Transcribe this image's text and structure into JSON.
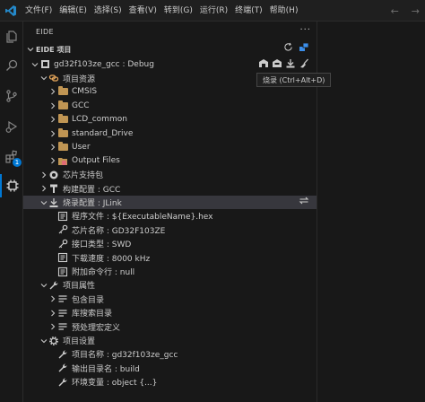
{
  "menubar": {
    "items": [
      "文件(F)",
      "编辑(E)",
      "选择(S)",
      "查看(V)",
      "转到(G)",
      "运行(R)",
      "终端(T)",
      "帮助(H)"
    ]
  },
  "sidebar": {
    "title": "EIDE",
    "more": "···",
    "section_title": "EIDE 项目",
    "project": {
      "label": "gd32f103ze_gcc : Debug",
      "children": [
        {
          "label": "项目资源",
          "icon": "link-icon",
          "children": [
            {
              "label": "CMSIS",
              "icon": "folder-icon"
            },
            {
              "label": "GCC",
              "icon": "folder-icon"
            },
            {
              "label": "LCD_common",
              "icon": "folder-icon"
            },
            {
              "label": "standard_Drive",
              "icon": "folder-icon"
            },
            {
              "label": "User",
              "icon": "folder-icon"
            },
            {
              "label": "Output Files",
              "icon": "output-folder-icon"
            }
          ]
        },
        {
          "label": "芯片支持包",
          "icon": "package-icon"
        },
        {
          "label": "构建配置 : GCC",
          "icon": "hammer-icon"
        },
        {
          "label": "烧录配置 : JLink",
          "icon": "download-icon",
          "children": [
            {
              "label": "程序文件 : ${ExecutableName}.hex",
              "icon": "file-list-icon"
            },
            {
              "label": "芯片名称 : GD32F103ZE",
              "icon": "key-icon"
            },
            {
              "label": "接口类型 : SWD",
              "icon": "key-icon"
            },
            {
              "label": "下载速度 : 8000 kHz",
              "icon": "file-list-icon"
            },
            {
              "label": "附加命令行 : null",
              "icon": "file-list-icon"
            }
          ]
        },
        {
          "label": "项目属性",
          "icon": "wrench-icon",
          "children": [
            {
              "label": "包含目录",
              "icon": "list-icon"
            },
            {
              "label": "库搜索目录",
              "icon": "list-icon"
            },
            {
              "label": "预处理宏定义",
              "icon": "list-icon"
            }
          ]
        },
        {
          "label": "项目设置",
          "icon": "gear-icon",
          "children": [
            {
              "label": "项目名称 : gd32f103ze_gcc",
              "icon": "wrench-icon"
            },
            {
              "label": "输出目录名 : build",
              "icon": "wrench-icon"
            },
            {
              "label": "环境变量 : object {...}",
              "icon": "wrench-icon"
            }
          ]
        }
      ]
    }
  },
  "tooltip": {
    "text": "烧录 (Ctrl+Alt+D)"
  },
  "activity": {
    "badge": "1"
  },
  "colors": {
    "accent": "#0078d4",
    "folder": "#c09553",
    "output": "#e06c75",
    "selected_row": "#37373d"
  }
}
